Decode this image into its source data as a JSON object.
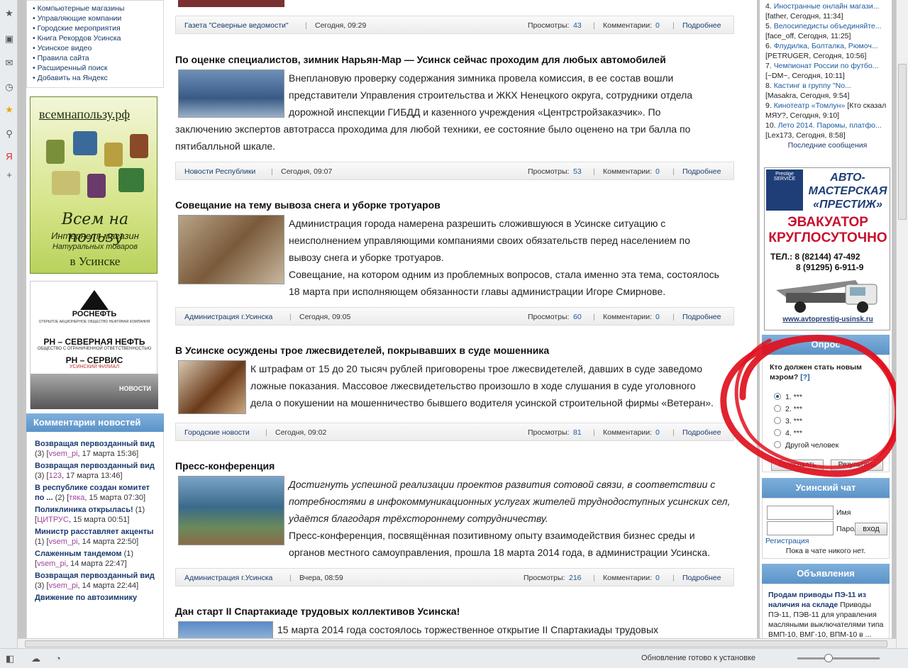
{
  "left_menu": [
    "Компьютерные магазины",
    "Управляющие компании",
    "Городские мероприятия",
    "Книга Рекордов Усинска",
    "Усинское видео",
    "Правила сайта",
    "Расширенный поиск",
    "Добавить на Яндекс"
  ],
  "ad1": {
    "site": "всемнапользу.рф",
    "line1": "Всем на пользу",
    "line2": "Интернет–магазин",
    "line3": "Натуральных товаров",
    "line4": "в Усинске"
  },
  "ad2": {
    "brand": "РОСНЕФТЬ",
    "brand_sub": "ОТКРЫТОЕ АКЦИОНЕРНОЕ ОБЩЕСТВО НЕФТЯНАЯ КОМПАНИЯ",
    "company1": "РН – СЕВЕРНАЯ НЕФТЬ",
    "company1_sub": "ОБЩЕСТВО С ОГРАНИЧЕННОЙ ОТВЕТСТВЕННОСТЬЮ",
    "company2": "РН – СЕРВИС",
    "company2_sub": "УСИНСКИЙ ФИЛИАЛ",
    "news": "НОВОСТИ"
  },
  "comments_header": "Комментарии новостей",
  "comments": [
    {
      "title": "Возвращая первозданный вид",
      "count": "(3)",
      "user": "vsem_pi",
      "date": ", 17 марта 15:36]"
    },
    {
      "title": "Возвращая первозданный вид",
      "count": "(3)",
      "user": "123",
      "date": ", 17 марта 13:46]"
    },
    {
      "title": "В республике создан комитет по ...",
      "count": "(2)",
      "user": "тяка",
      "date": ", 15 марта 07:30]"
    },
    {
      "title": "Поликлиника открылась!",
      "count": "(1)",
      "user": "ЦИТРУС",
      "date": ", 15 марта 00:51]"
    },
    {
      "title": "Министр расставляет акценты",
      "count": "(1)",
      "user": "vsem_pi",
      "date": ", 14 марта 22:50]"
    },
    {
      "title": "Слаженным тандемом",
      "count": "(1)",
      "user": "vsem_pi",
      "date": ", 14 марта 22:47]"
    },
    {
      "title": "Возвращая первозданный вид",
      "count": "(3)",
      "user": "vsem_pi",
      "date": ", 14 марта 22:44]"
    },
    {
      "title": "Движение по автозимнику",
      "count": "",
      "user": "",
      "date": ""
    }
  ],
  "articles": [
    {
      "title": "",
      "source": "Газета \"Северные ведомости\"",
      "time": "Сегодня, 09:29",
      "views_label": "Просмотры:",
      "views": "43",
      "comments_label": "Комментарии:",
      "comments": "0",
      "more": "Подробнее"
    },
    {
      "title": "По оценке специалистов, зимник Нарьян-Мар — Усинск сейчас проходим для любых автомобилей",
      "lines": [
        "Внеплановую проверку содержания зимника провела комиссия, в ее состав вошли",
        "представители Управления строительства и ЖКХ Ненецкого округа, сотрудники отдела",
        "дорожной инспекции ГИБДД и казенного учреждения «Центрстройзаказчик». По",
        "заключению экспертов автотрасса проходима для любой техники, ее состояние было оценено на три балла по",
        "пятибалльной шкале."
      ],
      "source": "Новости Республики",
      "time": "Сегодня, 09:07",
      "views_label": "Просмотры:",
      "views": "53",
      "comments_label": "Комментарии:",
      "comments": "0",
      "more": "Подробнее"
    },
    {
      "title": "Совещание на тему вывоза снега и уборке тротуаров",
      "lines": [
        "Администрация города намерена разрешить сложившуюся в Усинске ситуацию с",
        "неисполнением управляющими компаниями своих обязательств перед населением по",
        "вывозу снега и уборке тротуаров.",
        "Совещание, на котором одним из проблемных вопросов, стала именно эта тема, состоялось",
        "18 марта при исполняющем обязанности главы администрации Игоре Смирнове."
      ],
      "source": "Администрация г.Усинска",
      "time": "Сегодня, 09:05",
      "views_label": "Просмотры:",
      "views": "60",
      "comments_label": "Комментарии:",
      "comments": "0",
      "more": "Подробнее"
    },
    {
      "title": "В Усинске осуждены трое лжесвидетелей, покрывавших в суде мошенника",
      "lines": [
        "К штрафам от 15 до 20 тысяч рублей приговорены трое лжесвидетелей, давших в суде заведомо",
        "ложные показания. Массовое лжесвидетельство произошло в ходе слушания в суде уголовного",
        "дела о покушении на мошенничество бывшего водителя усинской строительной фирмы «Ветеран»."
      ],
      "source": "Городские новости",
      "time": "Сегодня, 09:02",
      "views_label": "Просмотры:",
      "views": "81",
      "comments_label": "Комментарии:",
      "comments": "0",
      "more": "Подробнее"
    },
    {
      "title": "Пресс-конференция",
      "lines": [
        "Достигнуть успешной реализации проектов развития сотовой связи, в соответствии с",
        "потребностями в инфокоммуникационных услугах жителей труднодоступных усинских сел,",
        "удаётся благодаря трёхстороннему сотрудничеству.",
        "Пресс-конференция, посвящённая позитивному опыту взаимодействия бизнес среды и",
        "органов местного самоуправления, прошла 18 марта 2014 года, в администрации Усинска."
      ],
      "source": "Администрация г.Усинска",
      "time": "Вчера, 08:59",
      "views_label": "Просмотры:",
      "views": "216",
      "comments_label": "Комментарии:",
      "comments": "0",
      "more": "Подробнее"
    },
    {
      "title": "Дан старт II Спартакиаде трудовых коллективов Усинска!",
      "lines": [
        "15 марта 2014 года состоялось торжественное открытие II Спартакиады трудовых"
      ]
    }
  ],
  "last_posts": [
    {
      "n": "4.",
      "title": "Иностранные онлайн магази...",
      "meta": "[father, Сегодня, 11:34]"
    },
    {
      "n": "5.",
      "title": "Велосипедисты объединяйте...",
      "meta": "[face_off, Сегодня, 11:25]"
    },
    {
      "n": "6.",
      "title": "Флудилка, Болталка, Рюмоч...",
      "meta": "[PETRUGER, Сегодня, 10:56]"
    },
    {
      "n": "7.",
      "title": "Чемпионат России по футбо...",
      "meta": "[~DM~, Сегодня, 10:11]"
    },
    {
      "n": "8.",
      "title": "Кастинг в группу \"No...",
      "meta": "[Masakra, Сегодня, 9:54]"
    },
    {
      "n": "9.",
      "title": "Кинотеатр «Томлун»",
      "meta": "[Кто сказал МЯУ?, Сегодня, 9:10]"
    },
    {
      "n": "10.",
      "title": "Лето 2014. Паромы, платфо...",
      "meta": "[Lex173, Сегодня, 8:58]"
    }
  ],
  "last_posts_more": "Последние сообщения",
  "ad3": {
    "badge": "Prestige SERVICE",
    "title": "АВТО-МАСТЕРСКАЯ «ПРЕСТИЖ»",
    "title2": "ЭВАКУАТОР КРУГЛОСУТОЧНО",
    "tel1": "ТЕЛ.: 8 (82144)  47-492",
    "tel2": "8 (91295) 6-911-9",
    "url": "www.avtoprestig-usinsk.ru"
  },
  "poll": {
    "header": "Опрос",
    "question": "Кто должен стать новым мэром?",
    "help": "[?]",
    "options": [
      "1. ***",
      "2. ***",
      "3. ***",
      "4. ***",
      "Другой человек"
    ],
    "vote": "Голосовать",
    "results": "Результаты"
  },
  "chat": {
    "header": "Усинский чат",
    "name_label": "Имя",
    "pass_label": "Пароль",
    "login": "вход",
    "register": "Регистрация",
    "empty": "Пока в чате никого нет."
  },
  "ads": {
    "header": "Объявления",
    "title": "Продам приводы ПЭ-11 из наличия на складе",
    "text": "Приводы ПЭ-11, ПЭВ-11 для управления масляными выключателями типа ВМП-10, ВМГ-10, ВПМ-10 в ..."
  },
  "status": {
    "message": "Обновление готово к установке"
  }
}
